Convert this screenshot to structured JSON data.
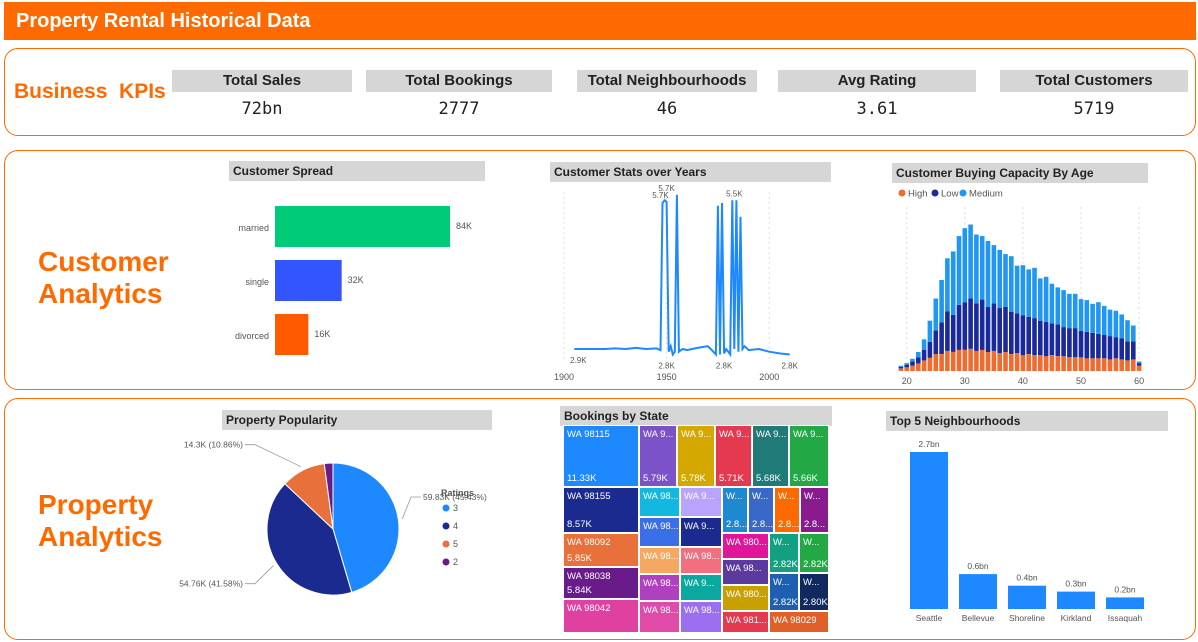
{
  "header": {
    "title": "Property Rental Historical Data"
  },
  "sections": {
    "kpis": "Business  KPIs",
    "customer_line1": "Customer",
    "customer_line2": "Analytics",
    "property_line1": "Property",
    "property_line2": "Analytics"
  },
  "kpis": [
    {
      "label": "Total Sales",
      "value": "72bn"
    },
    {
      "label": "Total Bookings",
      "value": "2777"
    },
    {
      "label": "Total Neighbourhoods",
      "value": "46"
    },
    {
      "label": "Avg Rating",
      "value": "3.61"
    },
    {
      "label": "Total Customers",
      "value": "5719"
    }
  ],
  "colors": {
    "accent": "#ff6a00",
    "title_bg": "#d6d6d6"
  },
  "chart_data": [
    {
      "id": "customer_spread",
      "type": "bar",
      "orientation": "horizontal",
      "title": "Customer Spread",
      "categories": [
        "married",
        "single",
        "divorced"
      ],
      "values": [
        84,
        32,
        16
      ],
      "value_labels": [
        "84K",
        "32K",
        "16K"
      ],
      "colors": [
        "#00cc77",
        "#3355ff",
        "#ff5a00"
      ],
      "xlim": [
        0,
        84
      ]
    },
    {
      "id": "customer_stats_years",
      "type": "line",
      "title": "Customer Stats over Years",
      "x_ticks": [
        1900,
        1950,
        2000
      ],
      "xlim": [
        1900,
        2015
      ],
      "ylim": [
        2.7,
        5.75
      ],
      "x": [
        1905,
        1910,
        1915,
        1920,
        1925,
        1930,
        1935,
        1940,
        1945,
        1947,
        1948,
        1949,
        1950,
        1951,
        1952,
        1953,
        1954,
        1955,
        1956,
        1957,
        1958,
        1960,
        1965,
        1970,
        1972,
        1974,
        1975,
        1976,
        1977,
        1978,
        1979,
        1980,
        1981,
        1982,
        1983,
        1984,
        1985,
        1986,
        1987,
        1988,
        1990,
        1995,
        2000,
        2005,
        2010
      ],
      "y": [
        2.9,
        2.9,
        2.9,
        2.9,
        2.91,
        2.9,
        2.92,
        2.9,
        2.91,
        2.88,
        5.55,
        5.6,
        5.57,
        2.85,
        2.95,
        2.8,
        2.85,
        5.7,
        2.85,
        2.88,
        2.9,
        2.88,
        2.92,
        2.95,
        2.88,
        2.8,
        5.5,
        2.8,
        5.55,
        2.82,
        2.9,
        2.85,
        2.8,
        5.6,
        2.9,
        5.6,
        2.85,
        5.3,
        2.9,
        2.95,
        2.88,
        2.9,
        2.85,
        2.82,
        2.8
      ],
      "annotations": [
        {
          "x": 1907,
          "y": 2.9,
          "text": "2.9K"
        },
        {
          "x": 1950,
          "y": 5.7,
          "text": "5.7K"
        },
        {
          "x": 1947,
          "y": 5.57,
          "text": "5.7K"
        },
        {
          "x": 1983,
          "y": 5.6,
          "text": "5.5K"
        },
        {
          "x": 1950,
          "y": 2.8,
          "text": "2.8K"
        },
        {
          "x": 1978,
          "y": 2.8,
          "text": "2.8K"
        },
        {
          "x": 2010,
          "y": 2.8,
          "text": "2.8K"
        }
      ]
    },
    {
      "id": "buying_capacity_age",
      "type": "bar",
      "stacked": true,
      "title": "Customer Buying Capacity By Age",
      "legend_position": "top-left",
      "series": [
        {
          "name": "High",
          "color": "#ef6b2f",
          "values": [
            0.005,
            0.007,
            0.01,
            0.014,
            0.02,
            0.025,
            0.032,
            0.032,
            0.038,
            0.036,
            0.04,
            0.04,
            0.042,
            0.038,
            0.04,
            0.036,
            0.038,
            0.034,
            0.036,
            0.032,
            0.034,
            0.03,
            0.032,
            0.03,
            0.03,
            0.028,
            0.03,
            0.028,
            0.028,
            0.026,
            0.026,
            0.026,
            0.024,
            0.024,
            0.024,
            0.024,
            0.022,
            0.024,
            0.022,
            0.02,
            0.022,
            0.01
          ]
        },
        {
          "name": "Low",
          "color": "#1a2a9c",
          "values": [
            0.003,
            0.005,
            0.008,
            0.012,
            0.02,
            0.03,
            0.045,
            0.06,
            0.075,
            0.07,
            0.085,
            0.09,
            0.095,
            0.09,
            0.095,
            0.085,
            0.09,
            0.085,
            0.085,
            0.08,
            0.075,
            0.075,
            0.07,
            0.07,
            0.065,
            0.065,
            0.06,
            0.06,
            0.055,
            0.055,
            0.055,
            0.05,
            0.05,
            0.048,
            0.046,
            0.044,
            0.044,
            0.04,
            0.04,
            0.036,
            0.034,
            0.005
          ]
        },
        {
          "name": "Medium",
          "color": "#2196f3",
          "values": [
            0.002,
            0.003,
            0.005,
            0.01,
            0.02,
            0.04,
            0.06,
            0.08,
            0.1,
            0.12,
            0.13,
            0.14,
            0.14,
            0.13,
            0.12,
            0.125,
            0.11,
            0.11,
            0.1,
            0.105,
            0.09,
            0.095,
            0.09,
            0.095,
            0.08,
            0.085,
            0.075,
            0.07,
            0.07,
            0.065,
            0.065,
            0.06,
            0.06,
            0.055,
            0.06,
            0.055,
            0.05,
            0.05,
            0.045,
            0.04,
            0.03,
            0.003
          ]
        }
      ],
      "x_start": 19,
      "x_end": 60,
      "x_ticks": [
        20,
        30,
        40,
        50,
        60
      ],
      "ylim": [
        0,
        0.31
      ]
    },
    {
      "id": "property_popularity",
      "type": "pie",
      "title": "Property Popularity",
      "legend_title": "Ratings",
      "slices": [
        {
          "label": "3",
          "value": 59.83,
          "display": "59.83K (45.43%)",
          "color": "#1e88ff"
        },
        {
          "label": "4",
          "value": 54.76,
          "display": "54.76K (41.58%)",
          "color": "#1a2a8f"
        },
        {
          "label": "5",
          "value": 14.3,
          "display": "14.3K (10.86%)",
          "color": "#e8703a"
        },
        {
          "label": "2",
          "value": 2.79,
          "display": "",
          "color": "#6a1b8a"
        }
      ]
    },
    {
      "id": "bookings_by_state",
      "type": "treemap",
      "title": "Bookings by State",
      "cells": [
        {
          "name": "WA 98115",
          "value": "11.33K",
          "color": "#1e88ff"
        },
        {
          "name": "WA 98155",
          "value": "8.57K",
          "color": "#1a2a8f"
        },
        {
          "name": "WA 98092",
          "value": "5.85K",
          "color": "#e8703a"
        },
        {
          "name": "WA 98038",
          "value": "5.84K",
          "color": "#6a1b8a"
        },
        {
          "name": "WA 98042",
          "value": "",
          "color": "#e040a0"
        },
        {
          "name": "WA 9...",
          "value": "5.79K",
          "color": "#7b52c8"
        },
        {
          "name": "WA 9...",
          "value": "5.78K",
          "color": "#d4a800"
        },
        {
          "name": "WA 9...",
          "value": "5.71K",
          "color": "#e53950"
        },
        {
          "name": "WA 9...",
          "value": "5.68K",
          "color": "#1f7a78"
        },
        {
          "name": "WA 9...",
          "value": "5.66K",
          "color": "#22a845"
        },
        {
          "name": "WA 98...",
          "value": "",
          "color": "#12b8e0"
        },
        {
          "name": "WA 9...",
          "value": "",
          "color": "#b8a3ff"
        },
        {
          "name": "WA 98...",
          "value": "",
          "color": "#3a6fe8"
        },
        {
          "name": "WA 9...",
          "value": "",
          "color": "#1a2a8f"
        },
        {
          "name": "WA 98...",
          "value": "",
          "color": "#f4a860"
        },
        {
          "name": "WA 98...",
          "value": "",
          "color": "#f07080"
        },
        {
          "name": "WA 98...",
          "value": "",
          "color": "#b040c0"
        },
        {
          "name": "WA 9...",
          "value": "",
          "color": "#0ba8a0"
        },
        {
          "name": "WA 98...",
          "value": "",
          "color": "#e04aa8"
        },
        {
          "name": "WA 98...",
          "value": "",
          "color": "#9c6ff0"
        },
        {
          "name": "W...",
          "value": "2.8...",
          "color": "#1e88d0"
        },
        {
          "name": "W...",
          "value": "2.8...",
          "color": "#3a68c8"
        },
        {
          "name": "W...",
          "value": "2.8...",
          "color": "#ff6a00"
        },
        {
          "name": "W...",
          "value": "2.8...",
          "color": "#8a1a90"
        },
        {
          "name": "WA 980...",
          "value": "",
          "color": "#e0159a"
        },
        {
          "name": "WA 98...",
          "value": "",
          "color": "#5b3aa0"
        },
        {
          "name": "WA 980...",
          "value": "",
          "color": "#c8a000"
        },
        {
          "name": "WA 981...",
          "value": "",
          "color": "#e53950"
        },
        {
          "name": "WA 98029",
          "value": "",
          "color": "#e0602a"
        },
        {
          "name": "W...",
          "value": "2.82K",
          "color": "#12a080"
        },
        {
          "name": "W...",
          "value": "2.82K",
          "color": "#22a845"
        },
        {
          "name": "W...",
          "value": "",
          "color": "#0a8a3a"
        },
        {
          "name": "W...",
          "value": "2.82K",
          "color": "#1e5fb0"
        },
        {
          "name": "W...",
          "value": "2.80K",
          "color": "#102a60"
        }
      ]
    },
    {
      "id": "top5_neighbourhoods",
      "type": "bar",
      "title": "Top 5 Neighbourhoods",
      "categories": [
        "Seattle",
        "Bellevue",
        "Shoreline",
        "Kirkland",
        "Issaquah"
      ],
      "values": [
        2.7,
        0.6,
        0.4,
        0.3,
        0.2
      ],
      "value_labels": [
        "2.7bn",
        "0.6bn",
        "0.4bn",
        "0.3bn",
        "0.2bn"
      ],
      "color": "#1e88ff",
      "ylim": [
        0,
        2.7
      ]
    }
  ]
}
